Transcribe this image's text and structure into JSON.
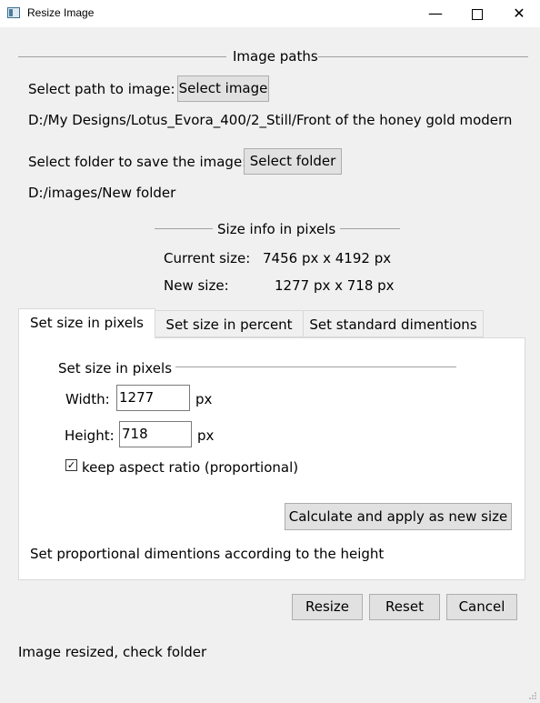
{
  "window": {
    "title": "Resize Image",
    "minimize_icon": "minimize-icon",
    "maximize_icon": "maximize-icon",
    "close_icon": "close-icon"
  },
  "paths": {
    "group_title": "Image paths",
    "select_image_label": "Select path to image:",
    "select_image_button": "Select image",
    "image_path": "D:/My Designs/Lotus_Evora_400/2_Still/Front of the honey gold modern",
    "select_folder_label": "Select folder to save the image:",
    "select_folder_button": "Select folder",
    "folder_path": "D:/images/New folder"
  },
  "size_info": {
    "group_title": "Size info in pixels",
    "current_label": "Current size:",
    "current_value": "7456 px x 4192 px",
    "new_label": "New size:",
    "new_value": "1277 px x 718 px"
  },
  "tabs": [
    {
      "label": "Set size in pixels",
      "active": true
    },
    {
      "label": "Set size in percent",
      "active": false
    },
    {
      "label": "Set standard dimentions",
      "active": false
    }
  ],
  "pixels_panel": {
    "group_title": "Set size in pixels",
    "width_label": "Width:",
    "width_value": "1277",
    "width_unit": "px",
    "height_label": "Height:",
    "height_value": "718",
    "height_unit": "px",
    "keep_aspect_label": "keep aspect ratio (proportional)",
    "keep_aspect_checked": true,
    "calculate_button": "Calculate and apply as new size",
    "hint": "Set proportional dimentions according to the height"
  },
  "actions": {
    "resize": "Resize",
    "reset": "Reset",
    "cancel": "Cancel"
  },
  "status": "Image resized, check folder"
}
